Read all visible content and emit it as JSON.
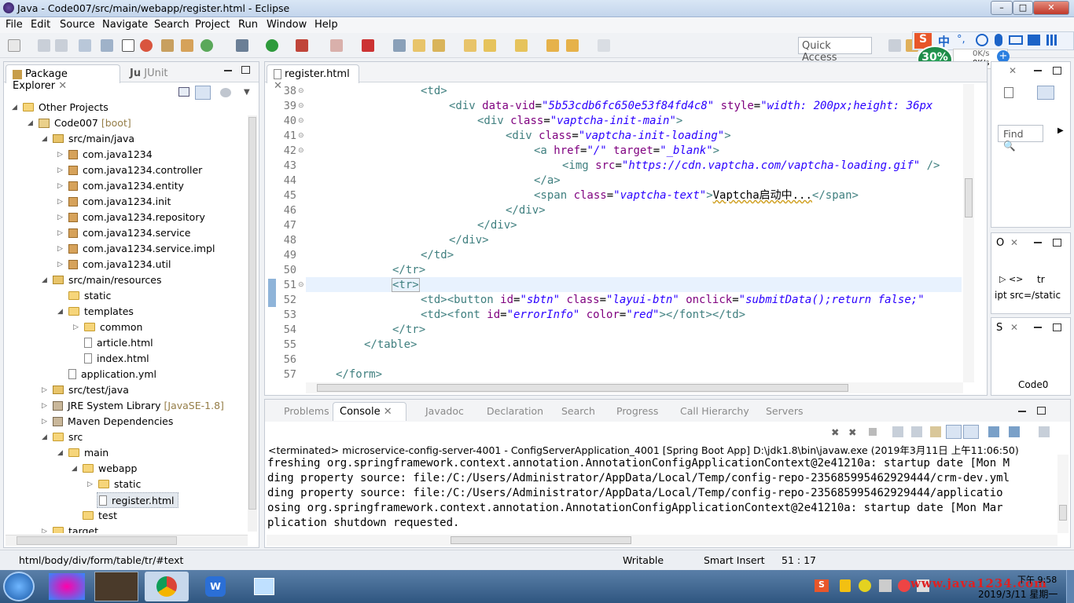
{
  "window": {
    "title": "Java - Code007/src/main/webapp/register.html - Eclipse"
  },
  "menu": [
    "File",
    "Edit",
    "Source",
    "Navigate",
    "Search",
    "Project",
    "Run",
    "Window",
    "Help"
  ],
  "toolbar": {
    "quick_access": "Quick Access"
  },
  "overlay": {
    "percent": "30%",
    "net_up": "0K/s",
    "net_down": "0K/s"
  },
  "package_explorer": {
    "tab_label": "Package Explorer",
    "tab2_label": "JUnit",
    "tree": [
      {
        "label": "Other Projects",
        "suffix": "",
        "icon": "folder-icon"
      },
      {
        "label": "Code007",
        "suffix": "[boot]",
        "icon": "project-icon"
      },
      {
        "label": "src/main/java",
        "suffix": "",
        "icon": "source-folder-icon"
      },
      {
        "label": "com.java1234",
        "suffix": "",
        "icon": "package-icon"
      },
      {
        "label": "com.java1234.controller",
        "suffix": "",
        "icon": "package-icon"
      },
      {
        "label": "com.java1234.entity",
        "suffix": "",
        "icon": "package-icon"
      },
      {
        "label": "com.java1234.init",
        "suffix": "",
        "icon": "package-icon"
      },
      {
        "label": "com.java1234.repository",
        "suffix": "",
        "icon": "package-icon"
      },
      {
        "label": "com.java1234.service",
        "suffix": "",
        "icon": "package-icon"
      },
      {
        "label": "com.java1234.service.impl",
        "suffix": "",
        "icon": "package-icon"
      },
      {
        "label": "com.java1234.util",
        "suffix": "",
        "icon": "package-icon"
      },
      {
        "label": "src/main/resources",
        "suffix": "",
        "icon": "source-folder-icon"
      },
      {
        "label": "static",
        "suffix": "",
        "icon": "folder-icon"
      },
      {
        "label": "templates",
        "suffix": "",
        "icon": "folder-icon"
      },
      {
        "label": "common",
        "suffix": "",
        "icon": "folder-icon"
      },
      {
        "label": "article.html",
        "suffix": "",
        "icon": "file-icon"
      },
      {
        "label": "index.html",
        "suffix": "",
        "icon": "file-icon"
      },
      {
        "label": "application.yml",
        "suffix": "",
        "icon": "yml-file-icon"
      },
      {
        "label": "src/test/java",
        "suffix": "",
        "icon": "source-folder-icon"
      },
      {
        "label": "JRE System Library",
        "suffix": "[JavaSE-1.8]",
        "icon": "library-icon"
      },
      {
        "label": "Maven Dependencies",
        "suffix": "",
        "icon": "library-icon"
      },
      {
        "label": "src",
        "suffix": "",
        "icon": "folder-icon"
      },
      {
        "label": "main",
        "suffix": "",
        "icon": "folder-icon"
      },
      {
        "label": "webapp",
        "suffix": "",
        "icon": "folder-icon"
      },
      {
        "label": "static",
        "suffix": "",
        "icon": "folder-icon"
      },
      {
        "label": "register.html",
        "suffix": "",
        "icon": "file-icon"
      },
      {
        "label": "test",
        "suffix": "",
        "icon": "folder-icon"
      },
      {
        "label": "target",
        "suffix": "",
        "icon": "folder-icon"
      }
    ]
  },
  "editor": {
    "tab_label": "register.html",
    "lines": [
      {
        "n": "38",
        "fold": true
      },
      {
        "n": "39",
        "fold": true
      },
      {
        "n": "40",
        "fold": true
      },
      {
        "n": "41",
        "fold": true
      },
      {
        "n": "42",
        "fold": true
      },
      {
        "n": "43",
        "fold": false
      },
      {
        "n": "44",
        "fold": false
      },
      {
        "n": "45",
        "fold": false
      },
      {
        "n": "46",
        "fold": false
      },
      {
        "n": "47",
        "fold": false
      },
      {
        "n": "48",
        "fold": false
      },
      {
        "n": "49",
        "fold": false
      },
      {
        "n": "50",
        "fold": false
      },
      {
        "n": "51",
        "fold": true
      },
      {
        "n": "52",
        "fold": false
      },
      {
        "n": "53",
        "fold": false
      },
      {
        "n": "54",
        "fold": false
      },
      {
        "n": "55",
        "fold": false
      },
      {
        "n": "56",
        "fold": false
      },
      {
        "n": "57",
        "fold": false
      }
    ],
    "code": {
      "l38_tag": "<td>",
      "l39_a": "<div ",
      "l39_b": "data-vid",
      "l39_c": "=",
      "l39_d": "\"5b53cdb6fc650e53f84fd4c8\"",
      "l39_e": " style",
      "l39_f": "=",
      "l39_g": "\"width: 200px;height: 36px",
      "l40_a": "<div ",
      "l40_b": "class",
      "l40_c": "=",
      "l40_d": "\"vaptcha-init-main\"",
      "l40_e": ">",
      "l41_a": "<div ",
      "l41_b": "class",
      "l41_c": "=",
      "l41_d": "\"vaptcha-init-loading\"",
      "l41_e": ">",
      "l42_a": "<a ",
      "l42_b": "href",
      "l42_c": "=",
      "l42_d": "\"/\"",
      "l42_e": " target",
      "l42_f": "=",
      "l42_g": "\"_blank\"",
      "l42_h": ">",
      "l43_a": "<img ",
      "l43_b": "src",
      "l43_c": "=",
      "l43_d": "\"https://cdn.vaptcha.com/vaptcha-loading.gif\"",
      "l43_e": " />",
      "l44": "</a>",
      "l45_a": "<span ",
      "l45_b": "class",
      "l45_c": "=",
      "l45_d": "\"vaptcha-text\"",
      "l45_e": ">",
      "l45_f": "Vaptcha启动中...",
      "l45_g": "</span>",
      "l46": "</div>",
      "l47": "</div>",
      "l48": "</div>",
      "l49": "</td>",
      "l50": "</tr>",
      "l51": "<tr>",
      "l52_a": "<td><button ",
      "l52_b": "id",
      "l52_c": "=",
      "l52_d": "\"sbtn\"",
      "l52_e": " class",
      "l52_f": "=",
      "l52_g": "\"layui-btn\"",
      "l52_h": " onclick",
      "l52_i": "=",
      "l52_j": "\"submitData();return false;\"",
      "l53_a": "<td><font ",
      "l53_b": "id",
      "l53_c": "=",
      "l53_d": "\"errorInfo\"",
      "l53_e": " color",
      "l53_f": "=",
      "l53_g": "\"red\"",
      "l53_h": "></font></td>",
      "l54": "</tr>",
      "l55": "</table>",
      "l56": "",
      "l57": "</form>"
    }
  },
  "right_panels": {
    "find_label": "Find",
    "outline_tab": "O",
    "outline_tr": "tr",
    "outline_src": "ipt src=/static",
    "s_tab": "S",
    "code_node": "Code0"
  },
  "bottom": {
    "tabs": [
      "Problems",
      "Console",
      "Javadoc",
      "Declaration",
      "Search",
      "Progress",
      "Call Hierarchy",
      "Servers"
    ],
    "active_tab": "Console",
    "terminated": "<terminated> microservice-config-server-4001 - ConfigServerApplication_4001 [Spring Boot App] D:\\jdk1.8\\bin\\javaw.exe (2019年3月11日 上午11:06:50)",
    "console_lines": [
      "freshing org.springframework.context.annotation.AnnotationConfigApplicationContext@2e41210a: startup date [Mon M",
      "ding property source: file:/C:/Users/Administrator/AppData/Local/Temp/config-repo-235685995462929444/crm-dev.yml",
      "ding property source: file:/C:/Users/Administrator/AppData/Local/Temp/config-repo-235685995462929444/applicatio",
      "osing org.springframework.context.annotation.AnnotationConfigApplicationContext@2e41210a: startup date [Mon Mar",
      "plication shutdown requested."
    ]
  },
  "status": {
    "path": "html/body/div/form/table/tr/#text",
    "writable": "Writable",
    "insert_mode": "Smart Insert",
    "position": "51 : 17"
  },
  "taskbar": {
    "time": "下午 9:58",
    "date": "2019/3/11 星期一",
    "watermark": "www.java1234.com"
  },
  "colors": {
    "tag": "#3f7f7f",
    "attr": "#7f007f",
    "value": "#2a00ff",
    "highlight_line": "#e8f2fe"
  }
}
